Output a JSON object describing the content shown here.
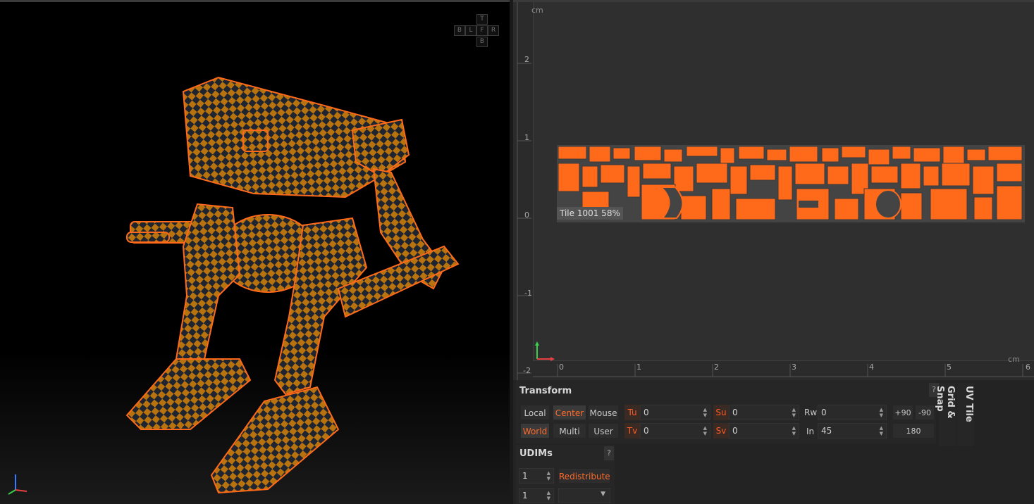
{
  "viewport": {
    "navcube": {
      "top": "T",
      "back_left": "B",
      "left": "L",
      "front": "F",
      "right": "R",
      "bottom": "B"
    }
  },
  "uv_editor": {
    "unit_top": "cm",
    "unit_right": "cm",
    "v_ticks": [
      "2",
      "1",
      "0",
      "-1",
      "-2"
    ],
    "u_ticks": [
      "0",
      "1",
      "2",
      "3",
      "4",
      "5",
      "6"
    ],
    "tile_label": "Tile 1001 58%",
    "accent": "#ff6a1a"
  },
  "transform": {
    "title": "Transform",
    "help": "?",
    "row1": {
      "local": "Local",
      "center": "Center",
      "mouse": "Mouse"
    },
    "row2": {
      "world": "World",
      "multi": "Multi",
      "user": "User"
    },
    "tu": {
      "label": "Tu",
      "value": "0"
    },
    "tv": {
      "label": "Tv",
      "value": "0"
    },
    "su": {
      "label": "Su",
      "value": "0"
    },
    "sv": {
      "label": "Sv",
      "value": "0"
    },
    "rw": {
      "label": "Rw",
      "value": "0"
    },
    "in": {
      "label": "In",
      "value": "45"
    },
    "rot_plus90": "+90",
    "rot_minus90": "-90",
    "rot_180": "180"
  },
  "udims": {
    "title": "UDIMs",
    "help": "?",
    "value1": "1",
    "value2": "1",
    "redistribute": "Redistribute",
    "dropdown": ""
  },
  "side_tabs": {
    "grid_snap": "Grid & Snap",
    "uv_tile": "UV Tile"
  }
}
